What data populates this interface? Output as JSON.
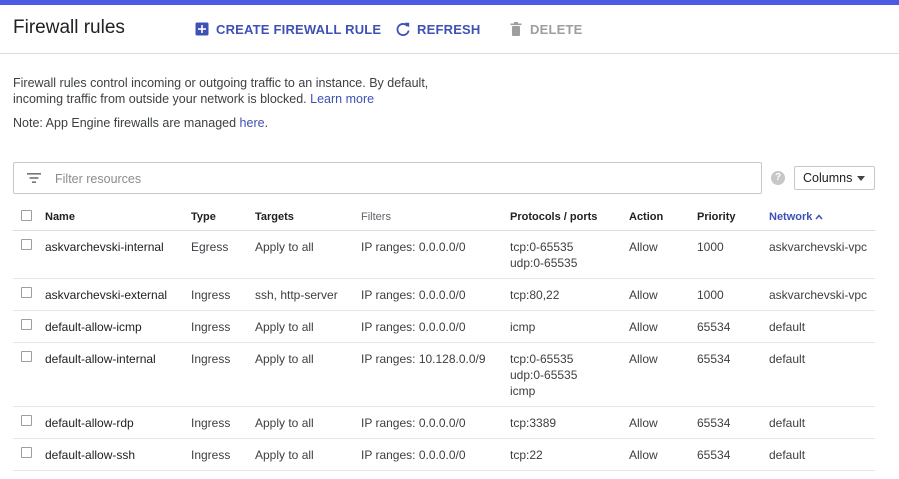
{
  "header": {
    "title": "Firewall rules",
    "create_label": "CREATE FIREWALL RULE",
    "refresh_label": "REFRESH",
    "delete_label": "DELETE"
  },
  "description": {
    "line1": "Firewall rules control incoming or outgoing traffic to an instance. By default,",
    "line2": "incoming traffic from outside your network is blocked.",
    "learn_more": "Learn more",
    "note_prefix": "Note: App Engine firewalls are managed",
    "note_link": "here",
    "note_suffix": "."
  },
  "filter": {
    "placeholder": "Filter resources",
    "columns_label": "Columns"
  },
  "table": {
    "columns": {
      "name": "Name",
      "type": "Type",
      "targets": "Targets",
      "filters": "Filters",
      "protocols": "Protocols / ports",
      "action": "Action",
      "priority": "Priority",
      "network": "Network"
    },
    "rows": [
      {
        "name": "askvarchevski-internal",
        "type": "Egress",
        "targets": "Apply to all",
        "filters": "IP ranges: 0.0.0.0/0",
        "protocols": [
          "tcp:0-65535",
          "udp:0-65535"
        ],
        "action": "Allow",
        "priority": "1000",
        "network": "askvarchevski-vpc"
      },
      {
        "name": "askvarchevski-external",
        "type": "Ingress",
        "targets": "ssh, http-server",
        "filters": "IP ranges: 0.0.0.0/0",
        "protocols": [
          "tcp:80,22"
        ],
        "action": "Allow",
        "priority": "1000",
        "network": "askvarchevski-vpc"
      },
      {
        "name": "default-allow-icmp",
        "type": "Ingress",
        "targets": "Apply to all",
        "filters": "IP ranges: 0.0.0.0/0",
        "protocols": [
          "icmp"
        ],
        "action": "Allow",
        "priority": "65534",
        "network": "default"
      },
      {
        "name": "default-allow-internal",
        "type": "Ingress",
        "targets": "Apply to all",
        "filters": "IP ranges: 10.128.0.0/9",
        "protocols": [
          "tcp:0-65535",
          "udp:0-65535",
          "icmp"
        ],
        "action": "Allow",
        "priority": "65534",
        "network": "default"
      },
      {
        "name": "default-allow-rdp",
        "type": "Ingress",
        "targets": "Apply to all",
        "filters": "IP ranges: 0.0.0.0/0",
        "protocols": [
          "tcp:3389"
        ],
        "action": "Allow",
        "priority": "65534",
        "network": "default"
      },
      {
        "name": "default-allow-ssh",
        "type": "Ingress",
        "targets": "Apply to all",
        "filters": "IP ranges: 0.0.0.0/0",
        "protocols": [
          "tcp:22"
        ],
        "action": "Allow",
        "priority": "65534",
        "network": "default"
      }
    ]
  },
  "colors": {
    "accent": "#3f51b5",
    "topbar": "#4d5be0",
    "disabled": "#9e9e9e"
  },
  "icons": {
    "create": "add-box-icon",
    "refresh": "refresh-icon",
    "delete": "trash-icon",
    "filter": "filter-list-icon",
    "help": "help-icon",
    "sort": "sort-ascending-icon",
    "dropdown": "caret-down-icon"
  }
}
